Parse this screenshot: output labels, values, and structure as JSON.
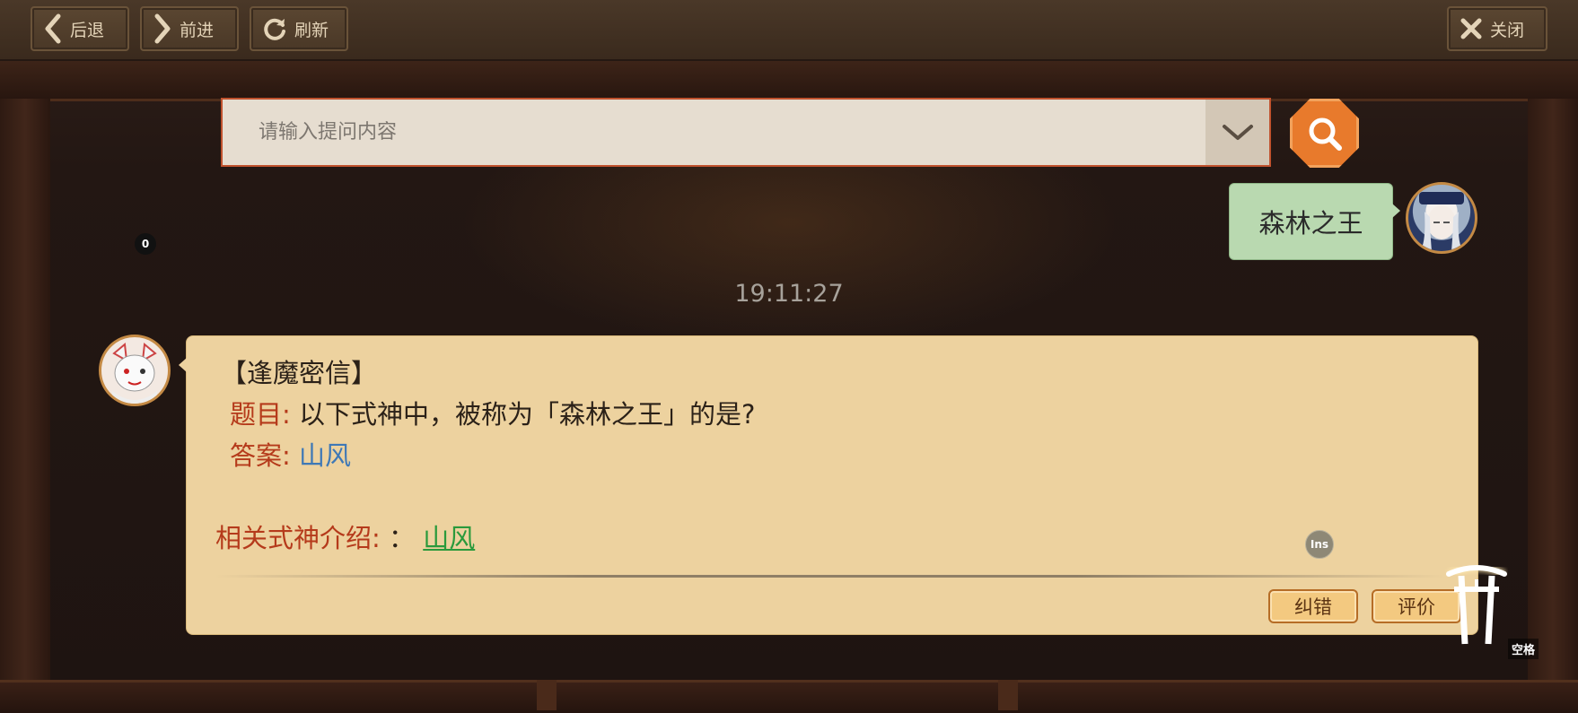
{
  "toolbar": {
    "back_label": "后退",
    "forward_label": "前进",
    "refresh_label": "刷新",
    "close_label": "关闭"
  },
  "search": {
    "placeholder": "请输入提问内容"
  },
  "badge_count": "0",
  "user_message": {
    "text": "森林之王"
  },
  "timestamp": "19:11:27",
  "bot_message": {
    "header": "【逢魔密信】",
    "question_label": "题目:",
    "question_text": "以下式神中，被称为「森林之王」的是?",
    "answer_label": "答案:",
    "answer_text": "山风",
    "related_label": "相关式神介绍:",
    "related_sep": "：",
    "related_link": "山风",
    "correct_button": "纠错",
    "rate_button": "评价"
  },
  "ins_badge": "Ins",
  "space_label": "空格",
  "colors": {
    "accent": "#e87a2c",
    "user_bubble": "#b9d9b0",
    "bot_bubble": "#edd29f",
    "label_red": "#b53a1b",
    "answer_blue": "#3e78b6",
    "link_green": "#2a9a3c"
  },
  "icons": [
    "chevron-left-icon",
    "chevron-right-icon",
    "refresh-icon",
    "close-icon",
    "chevron-down-icon",
    "search-icon",
    "torii-gate-icon"
  ]
}
